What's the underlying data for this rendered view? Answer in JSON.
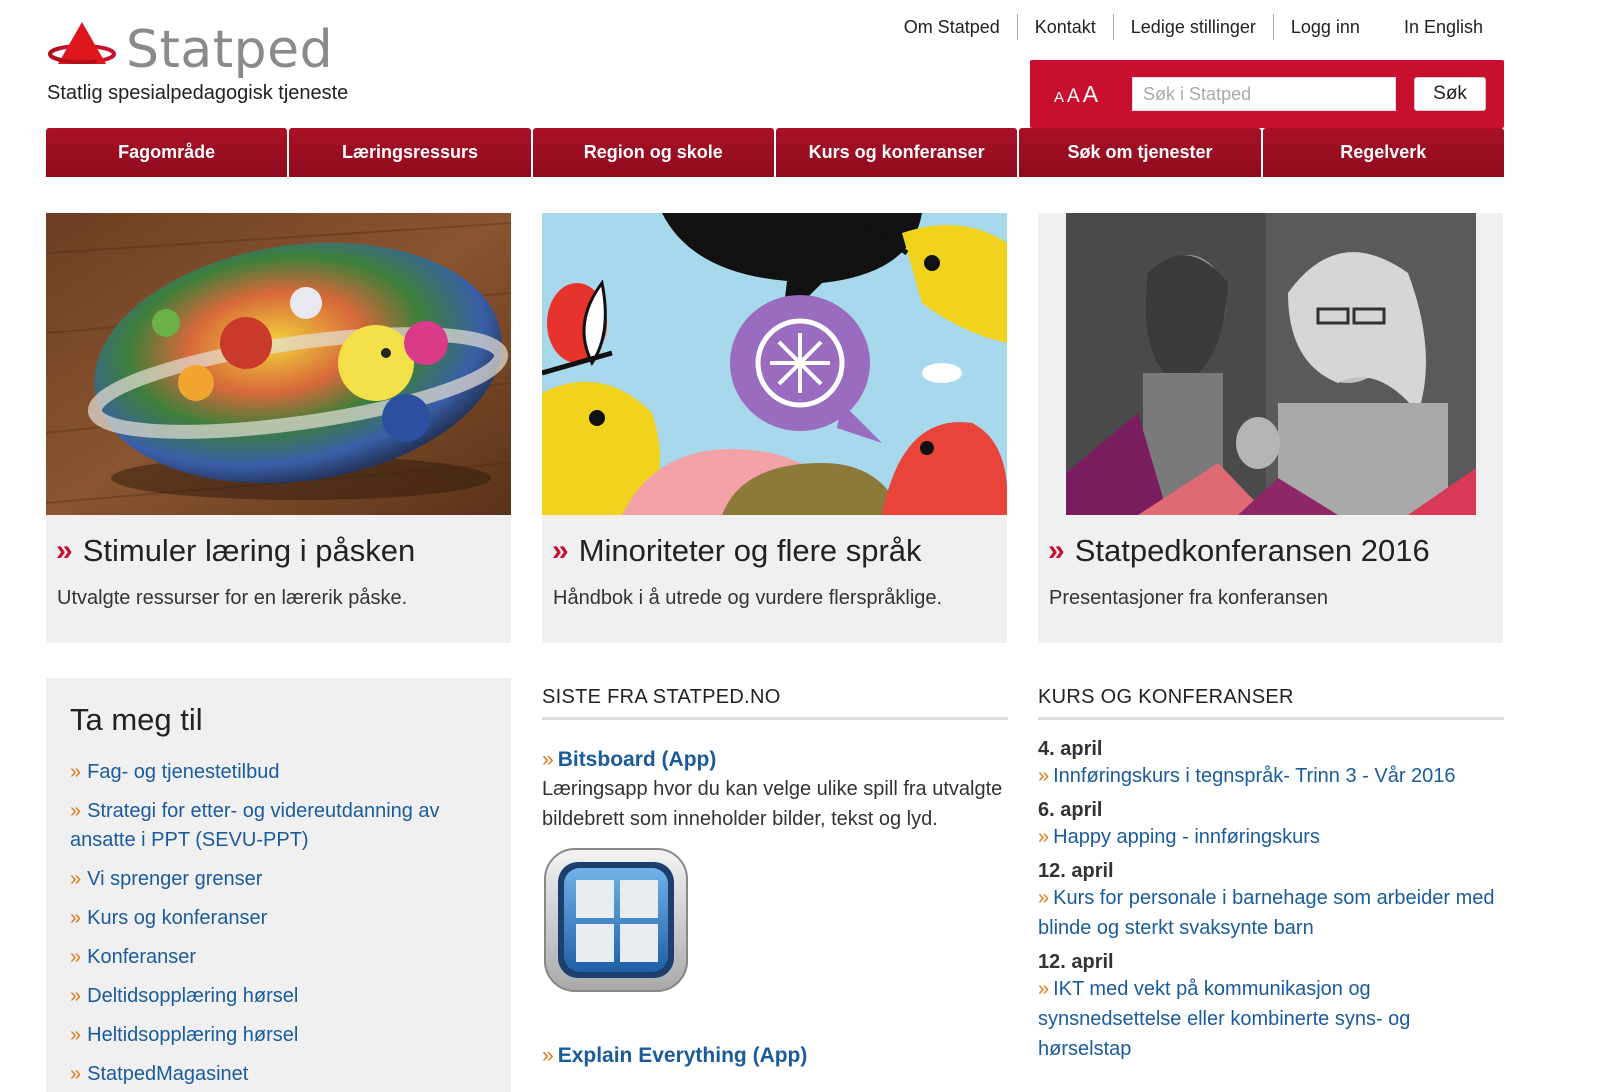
{
  "header": {
    "logo_text": "Statped",
    "tagline": "Statlig spesialpedagogisk tjeneste",
    "topnav": [
      "Om Statped",
      "Kontakt",
      "Ledige stillinger",
      "Logg inn"
    ],
    "english_link": "In English",
    "fontsize_labels": [
      "A",
      "A",
      "A"
    ],
    "search_placeholder": "Søk i Statped",
    "search_button": "Søk"
  },
  "mainnav": [
    "Fagområde",
    "Læringsressurs",
    "Region og skole",
    "Kurs og konferanser",
    "Søk om tjenester",
    "Regelverk"
  ],
  "cards": [
    {
      "title": "Stimuler læring i påsken",
      "subtitle": "Utvalgte ressurser for en lærerik påske."
    },
    {
      "title": "Minoriteter og flere språk",
      "subtitle": "Håndbok i å utrede og vurdere flerspråklige."
    },
    {
      "title": "Statpedkonferansen 2016",
      "subtitle": "Presentasjoner fra konferansen"
    }
  ],
  "chevron": "»",
  "takeme": {
    "heading": "Ta meg til",
    "links": [
      "Fag- og tjenestetilbud",
      "Strategi for etter- og videreutdanning av ansatte i PPT (SEVU-PPT)",
      "Vi sprenger grenser",
      "Kurs og konferanser",
      "Konferanser",
      "Deltidsopplæring hørsel",
      "Heltidsopplæring hørsel",
      "StatpedMagasinet"
    ]
  },
  "news": {
    "heading": "SISTE FRA STATPED.NO",
    "items": [
      {
        "title": "Bitsboard (App)",
        "desc": "Læringsapp hvor du kan velge ulike spill fra utvalgte bildebrett som inneholder bilder, tekst og lyd."
      },
      {
        "title": "Explain Everything (App)",
        "desc": ""
      }
    ]
  },
  "kurs": {
    "heading": "KURS OG KONFERANSER",
    "items": [
      {
        "date": "4. april",
        "title": "Innføringskurs i tegnspråk- Trinn 3 - Vår 2016"
      },
      {
        "date": "6. april",
        "title": "Happy apping - innføringskurs"
      },
      {
        "date": "12. april",
        "title": "Kurs for personale i barnehage som arbeider med blinde og sterkt svaksynte barn"
      },
      {
        "date": "12. april",
        "title": "IKT med vekt på kommunikasjon og synsnedsettelse eller kombinerte syns- og hørselstap"
      }
    ]
  },
  "colors": {
    "brand_red": "#c8102e",
    "nav_red": "#9b0e22",
    "link_blue": "#1a5b9c",
    "chevron_orange": "#e07a1a"
  }
}
